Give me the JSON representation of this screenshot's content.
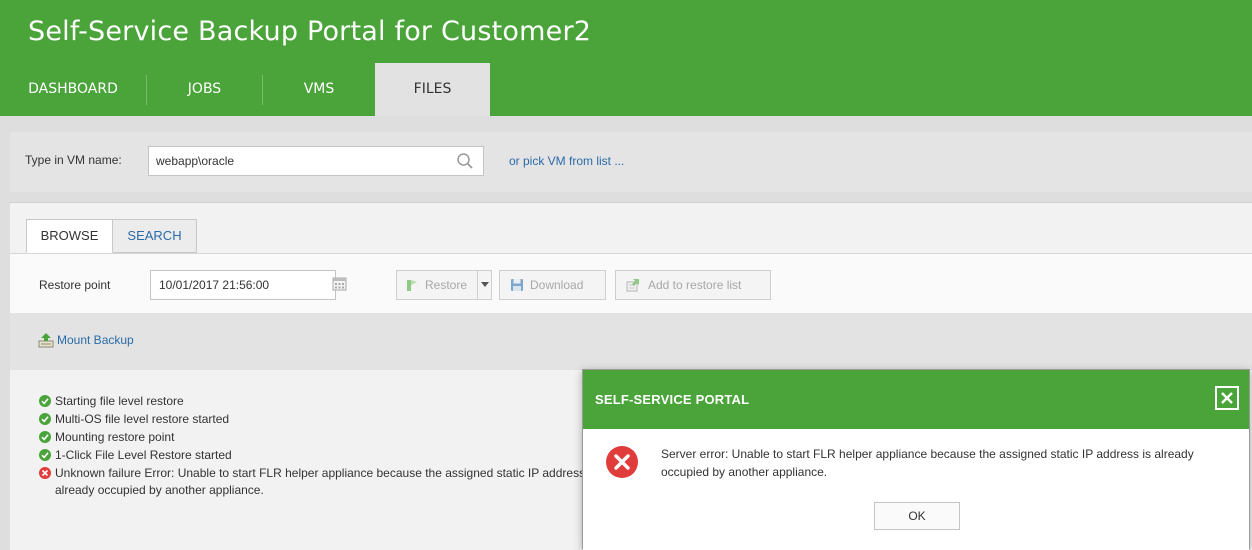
{
  "app": {
    "title": "Self-Service Backup Portal for Customer2"
  },
  "nav": {
    "tabs": [
      {
        "label": "DASHBOARD"
      },
      {
        "label": "JOBS"
      },
      {
        "label": "VMS"
      },
      {
        "label": "FILES",
        "active": true
      }
    ]
  },
  "vm_selector": {
    "label": "Type in VM name:",
    "value": "webapp\\oracle",
    "pick_link": "or pick VM from list ..."
  },
  "sub_tabs": [
    {
      "label": "BROWSE",
      "active": true
    },
    {
      "label": "SEARCH"
    }
  ],
  "restore": {
    "label": "Restore point",
    "value": "10/01/2017 21:56:00",
    "buttons": {
      "restore": "Restore",
      "download": "Download",
      "add": "Add to restore list"
    }
  },
  "mount": {
    "label": "Mount Backup"
  },
  "log": [
    {
      "text": "Starting file level restore",
      "status": "ok"
    },
    {
      "text": "Multi-OS file level restore started",
      "status": "ok"
    },
    {
      "text": "Mounting restore point",
      "status": "ok"
    },
    {
      "text": "1-Click File Level Restore started",
      "status": "ok"
    },
    {
      "text": "Unknown failure Error: Unable to start FLR helper appliance because the assigned static IP address is already occupied by another appliance.",
      "status": "error"
    }
  ],
  "dialog": {
    "title": "SELF-SERVICE PORTAL",
    "message": "Server error: Unable to start FLR helper appliance because the assigned static IP address is already occupied by another appliance.",
    "ok": "OK"
  },
  "colors": {
    "brand": "#4aa43a",
    "link": "#2a6ba8",
    "error": "#e03c3c",
    "success": "#4aa43a"
  }
}
